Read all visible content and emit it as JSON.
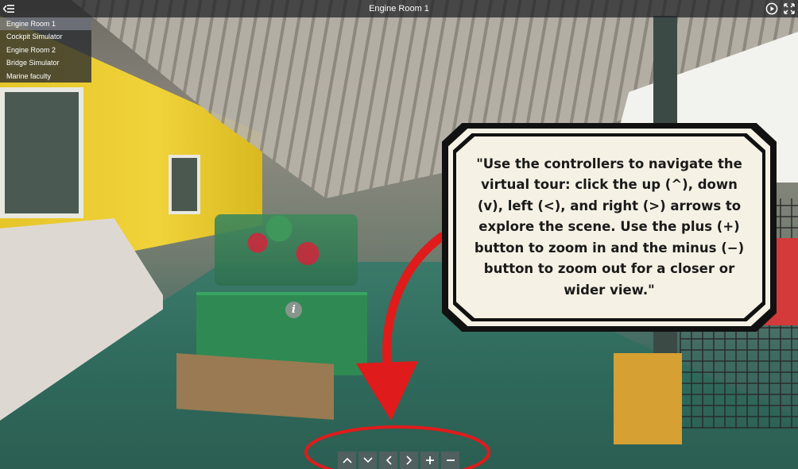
{
  "topbar": {
    "title": "Engine Room 1",
    "icons": [
      "menu-icon",
      "play-circle-icon",
      "fullscreen-icon"
    ]
  },
  "rooms": [
    {
      "label": "Engine Room 1",
      "active": true
    },
    {
      "label": "Cockpit Simulator",
      "active": false
    },
    {
      "label": "Engine Room 2",
      "active": false
    },
    {
      "label": "Bridge Simulator",
      "active": false
    },
    {
      "label": "Marine faculty",
      "active": false
    }
  ],
  "hotspot": {
    "symbol": "i",
    "icon": "info-icon"
  },
  "callout": {
    "text": "\"Use the controllers to navigate the virtual tour: click the up (^), down (v), left (<), and right (>) arrows to explore the scene. Use the plus (+) button to zoom in and the minus (−) button to zoom out for a closer or wider view.\""
  },
  "annotation": {
    "color": "#e01b1b"
  },
  "controls": [
    {
      "name": "up",
      "icon": "chevron-up-icon"
    },
    {
      "name": "down",
      "icon": "chevron-down-icon"
    },
    {
      "name": "left",
      "icon": "chevron-left-icon"
    },
    {
      "name": "right",
      "icon": "chevron-right-icon"
    },
    {
      "name": "zoom-in",
      "icon": "plus-icon"
    },
    {
      "name": "zoom-out",
      "icon": "minus-icon"
    }
  ]
}
